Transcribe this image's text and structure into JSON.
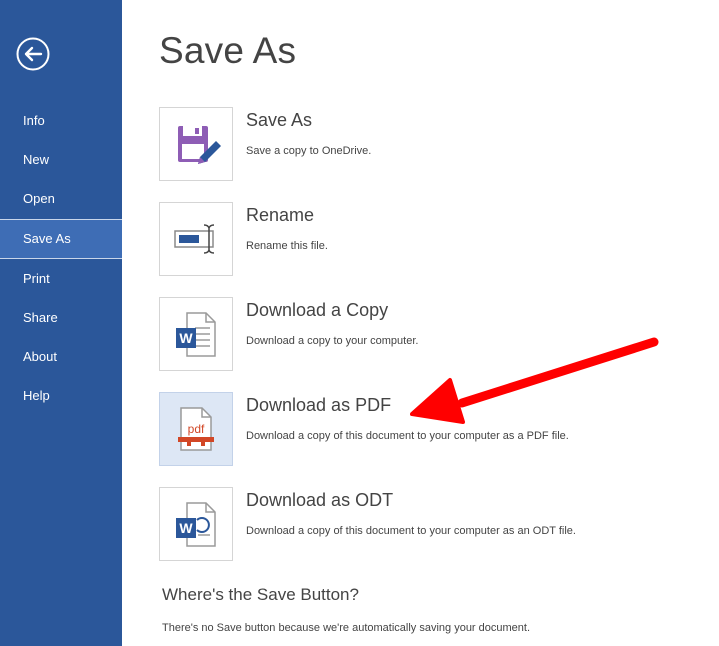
{
  "nav": {
    "back_icon": "back-arrow-icon",
    "items": [
      {
        "label": "Info",
        "selected": false
      },
      {
        "label": "New",
        "selected": false
      },
      {
        "label": "Open",
        "selected": false
      },
      {
        "label": "Save As",
        "selected": true
      },
      {
        "label": "Print",
        "selected": false
      },
      {
        "label": "Share",
        "selected": false
      },
      {
        "label": "About",
        "selected": false
      },
      {
        "label": "Help",
        "selected": false
      }
    ]
  },
  "main": {
    "title": "Save As",
    "options": [
      {
        "title": "Save As",
        "description": "Save a copy to OneDrive.",
        "icon": "floppy-disk-pencil-icon",
        "highlighted": false
      },
      {
        "title": "Rename",
        "description": "Rename this file.",
        "icon": "rename-textbox-icon",
        "highlighted": false
      },
      {
        "title": "Download a Copy",
        "description": "Download a copy to your computer.",
        "icon": "word-document-icon",
        "highlighted": false
      },
      {
        "title": "Download as PDF",
        "description": "Download a copy of this document to your computer as a PDF file.",
        "icon": "pdf-document-icon",
        "highlighted": true
      },
      {
        "title": "Download as ODT",
        "description": "Download a copy of this document to your computer as an ODT file.",
        "icon": "odt-document-icon",
        "highlighted": false
      }
    ],
    "pdf_icon_text": "pdf",
    "where_title": "Where's the Save Button?",
    "where_description": "There's no Save button because we're automatically saving your document."
  },
  "colors": {
    "sidebar": "#2b579a",
    "sidebar_selected": "#3e6db5",
    "word_blue": "#2b579a",
    "pdf_red": "#d24726",
    "floppy_purple": "#8e5db5",
    "annotation_arrow": "#ff0000"
  }
}
